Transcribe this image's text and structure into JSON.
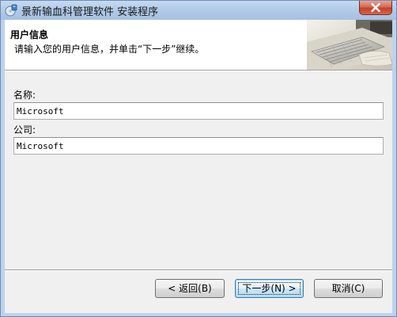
{
  "window": {
    "title": "景新输血科管理软件 安装程序",
    "close_icon": "close-x-icon",
    "app_icon": "installer-disc-icon"
  },
  "header": {
    "title": "用户信息",
    "subtitle": "请输入您的用户信息，并单击“下一步”继续。",
    "image": "office-keyboard-photo"
  },
  "form": {
    "name_label": "名称:",
    "name_value": "Microsoft",
    "company_label": "公司:",
    "company_value": "Microsoft"
  },
  "buttons": {
    "back": "< 返回(B)",
    "next": "下一步(N) >",
    "cancel": "取消(C)"
  }
}
